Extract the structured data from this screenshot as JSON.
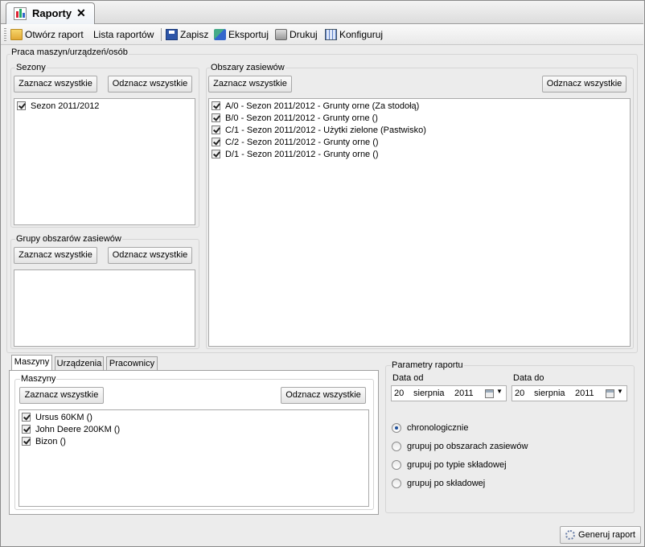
{
  "tab": {
    "title": "Raporty",
    "close": "✕"
  },
  "toolbar": {
    "open_report": "Otwórz raport",
    "report_list": "Lista raportów",
    "save": "Zapisz",
    "export": "Eksportuj",
    "print": "Drukuj",
    "configure": "Konfiguruj"
  },
  "main_group": "Praca maszyn/urządzeń/osób",
  "seasons": {
    "title": "Sezony",
    "select_all": "Zaznacz wszystkie",
    "deselect_all": "Odznacz wszystkie",
    "items": [
      "Sezon 2011/2012"
    ]
  },
  "areas": {
    "title": "Obszary zasiewów",
    "select_all": "Zaznacz wszystkie",
    "deselect_all": "Odznacz wszystkie",
    "items": [
      "A/0 - Sezon 2011/2012 - Grunty orne (Za stodołą)",
      "B/0 - Sezon 2011/2012 - Grunty orne ()",
      "C/1 - Sezon 2011/2012 - Użytki zielone (Pastwisko)",
      "C/2 - Sezon 2011/2012 - Grunty orne ()",
      "D/1 - Sezon 2011/2012 - Grunty orne ()"
    ]
  },
  "area_groups": {
    "title": "Grupy obszarów zasiewów",
    "select_all": "Zaznacz wszystkie",
    "deselect_all": "Odznacz wszystkie"
  },
  "bottom_tabs": [
    "Maszyny",
    "Urządzenia",
    "Pracownicy"
  ],
  "machines": {
    "title": "Maszyny",
    "select_all": "Zaznacz wszystkie",
    "deselect_all": "Odznacz wszystkie",
    "items": [
      "Ursus 60KM ()",
      "John Deere 200KM ()",
      "Bizon ()"
    ]
  },
  "params": {
    "title": "Parametry raportu",
    "date_from_label": "Data od",
    "date_to_label": "Data do",
    "date_from": {
      "day": "20",
      "month": "sierpnia",
      "year": "2011"
    },
    "date_to": {
      "day": "20",
      "month": "sierpnia",
      "year": "2011"
    },
    "options": [
      "chronologicznie",
      "grupuj po obszarach zasiewów",
      "grupuj po typie składowej",
      "grupuj po składowej"
    ],
    "selected": "chronologicznie"
  },
  "generate": "Generuj raport"
}
